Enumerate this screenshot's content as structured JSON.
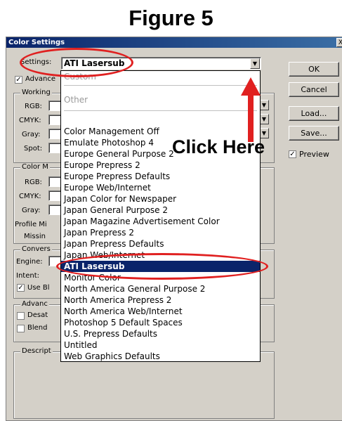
{
  "figure_title": "Figure 5",
  "dialog": {
    "title": "Color Settings",
    "close_label": "X",
    "settings_label": "Settings:",
    "settings_value": "ATI Lasersub",
    "advanced_label": "Advance",
    "working_label": "Working",
    "rgb_label": "RGB:",
    "cmyk_label": "CMYK:",
    "gray_label": "Gray:",
    "spot_label": "Spot:",
    "color_mgmt_label": "Color M",
    "rgb2_label": "RGB:",
    "cmyk2_label": "CMYK:",
    "gray2_label": "Gray:",
    "profile_mis_label": "Profile Mi",
    "missing_label": "Missin",
    "conversion_label": "Convers",
    "engine_label": "Engine:",
    "intent_label": "Intent:",
    "use_bl_label": "Use Bl",
    "advanced2_label": "Advanc",
    "desat_label": "Desat",
    "blend_label": "Blend",
    "description_label": "Descript"
  },
  "buttons": {
    "ok": "OK",
    "cancel": "Cancel",
    "load": "Load...",
    "save": "Save...",
    "preview": "Preview"
  },
  "dropdown_items": [
    {
      "label": "Custom",
      "style": "gray"
    },
    {
      "label": "Other",
      "style": "gray"
    },
    {
      "label": "Color Management Off",
      "style": ""
    },
    {
      "label": "Emulate Photoshop 4",
      "style": ""
    },
    {
      "label": "Europe General Purpose 2",
      "style": ""
    },
    {
      "label": "Europe Prepress 2",
      "style": ""
    },
    {
      "label": "Europe Prepress Defaults",
      "style": ""
    },
    {
      "label": "Europe Web/Internet",
      "style": ""
    },
    {
      "label": "Japan Color for Newspaper",
      "style": ""
    },
    {
      "label": "Japan General Purpose 2",
      "style": ""
    },
    {
      "label": "Japan Magazine Advertisement Color",
      "style": ""
    },
    {
      "label": "Japan Prepress 2",
      "style": ""
    },
    {
      "label": "Japan Prepress Defaults",
      "style": ""
    },
    {
      "label": "Japan Web/Internet",
      "style": ""
    },
    {
      "label": "ATI Lasersub",
      "style": "sel"
    },
    {
      "label": "Monitor Color",
      "style": ""
    },
    {
      "label": "North America General Purpose 2",
      "style": ""
    },
    {
      "label": "North America Prepress 2",
      "style": ""
    },
    {
      "label": "North America Web/Internet",
      "style": ""
    },
    {
      "label": "Photoshop 5 Default Spaces",
      "style": ""
    },
    {
      "label": "U.S. Prepress Defaults",
      "style": ""
    },
    {
      "label": "Untitled",
      "style": ""
    },
    {
      "label": "Web Graphics Defaults",
      "style": ""
    }
  ],
  "annotation": {
    "callout_text": "Click Here",
    "accent_color": "#e02020"
  }
}
